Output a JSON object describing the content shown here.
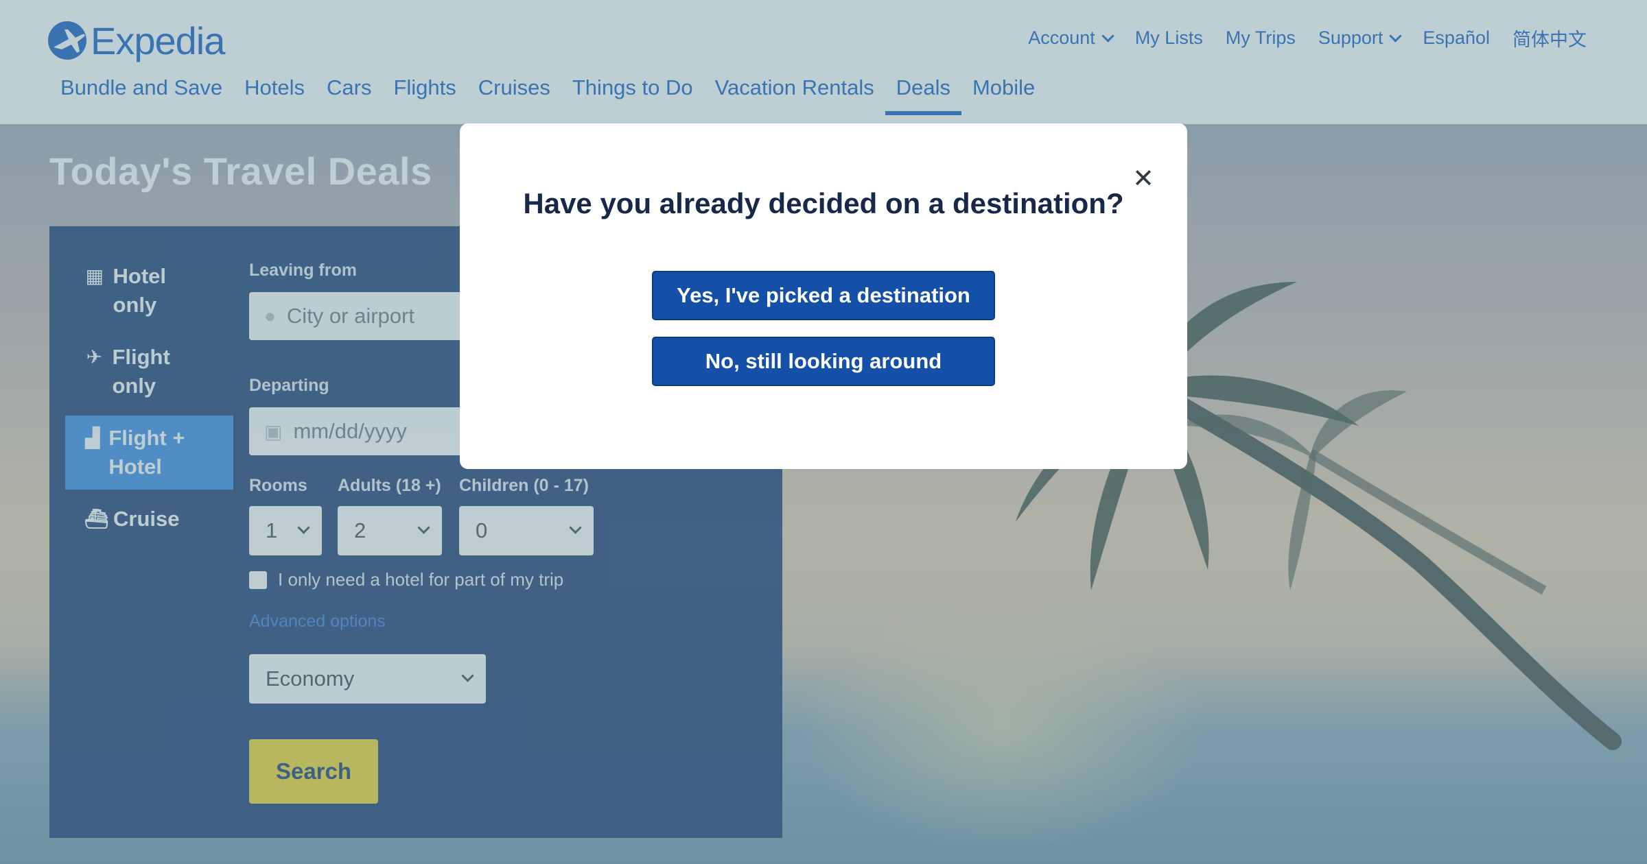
{
  "brand": {
    "name": "Expedia",
    "color": "#1d61c4"
  },
  "util_nav": {
    "account": "Account",
    "my_lists": "My Lists",
    "my_trips": "My Trips",
    "support": "Support",
    "espanol": "Español",
    "chinese": "简体中文"
  },
  "main_nav": [
    {
      "label": "Bundle and Save"
    },
    {
      "label": "Hotels"
    },
    {
      "label": "Cars"
    },
    {
      "label": "Flights"
    },
    {
      "label": "Cruises"
    },
    {
      "label": "Things to Do"
    },
    {
      "label": "Vacation Rentals"
    },
    {
      "label": "Deals",
      "active": true
    },
    {
      "label": "Mobile"
    }
  ],
  "hero": {
    "title": "Today's Travel Deals"
  },
  "search": {
    "tabs": [
      {
        "label": "Hotel only",
        "icon": "building-icon"
      },
      {
        "label": "Flight only",
        "icon": "airplane-icon"
      },
      {
        "label": "Flight + Hotel",
        "icon": "flight-hotel-icon",
        "active": true
      },
      {
        "label": "Cruise",
        "icon": "ship-icon"
      }
    ],
    "leaving_from": {
      "label": "Leaving from",
      "placeholder": "City or airport"
    },
    "departing": {
      "label": "Departing",
      "placeholder": "mm/dd/yyyy"
    },
    "rooms": {
      "label": "Rooms",
      "value": "1"
    },
    "adults": {
      "label": "Adults (18 +)",
      "value": "2"
    },
    "children": {
      "label": "Children (0 - 17)",
      "value": "0"
    },
    "partial_hotel": "I only need a hotel for part of my trip",
    "advanced_options": "Advanced options",
    "cabin_class": "Economy",
    "search_button": "Search",
    "colors": {
      "card": "#1d3c74",
      "active_tab": "#3b8be8",
      "search_button": "#f9d932"
    }
  },
  "modal": {
    "title": "Have you already decided on a destination?",
    "yes_button": "Yes, I've picked a destination",
    "no_button": "No, still looking around",
    "close_icon": "close-icon",
    "button_color": "#1450a8"
  }
}
